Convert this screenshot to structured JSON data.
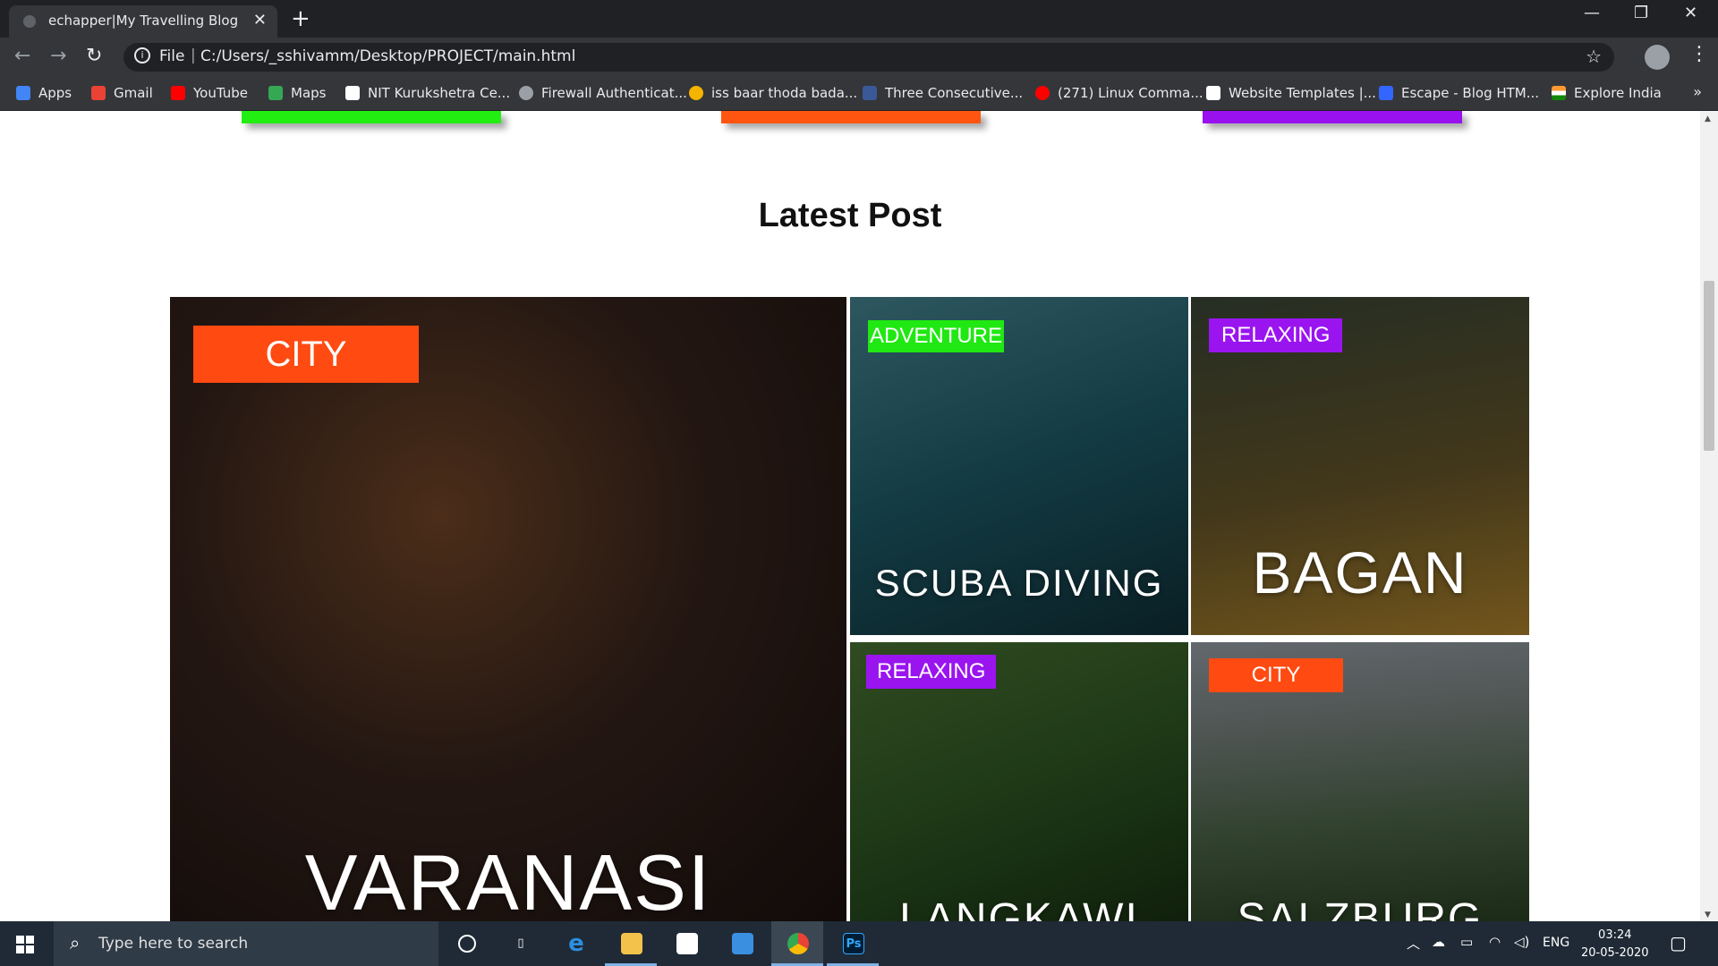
{
  "browser": {
    "tab_title": "echapper|My Travelling Blog",
    "new_tab": "+",
    "url_scheme": "File",
    "url": "C:/Users/_sshivamm/Desktop/PROJECT/main.html"
  },
  "bookmarks": [
    {
      "label": "Apps",
      "color": "#4285f4"
    },
    {
      "label": "Gmail",
      "color": "#ea4335"
    },
    {
      "label": "YouTube",
      "color": "#ff0000"
    },
    {
      "label": "Maps",
      "color": "#34a853"
    },
    {
      "label": "NIT Kurukshetra Ce...",
      "color": "#ffffff"
    },
    {
      "label": "Firewall Authenticat...",
      "color": "#9aa0a6"
    },
    {
      "label": "iss baar thoda bada...",
      "color": "#f4b400"
    },
    {
      "label": "Three Consecutive...",
      "color": "#3b5998"
    },
    {
      "label": "(271) Linux Comma...",
      "color": "#ff0000"
    },
    {
      "label": "Website Templates |...",
      "color": "#ffffff"
    },
    {
      "label": "Escape - Blog HTM...",
      "color": "#3366ff"
    },
    {
      "label": "Explore India",
      "color": "#ff9933"
    }
  ],
  "page": {
    "section_title": "Latest Post",
    "stripe_colors": [
      "#22ee11",
      "#ff5511",
      "#9911ee"
    ],
    "posts": [
      {
        "tag": "CITY",
        "tag_color": "#ff4a12",
        "place": "VARANASI",
        "bg": "#3a261e"
      },
      {
        "tag": "ADVENTURE",
        "tag_color": "#20e812",
        "place": "SCUBA DIVING",
        "bg": "#1f5f6c"
      },
      {
        "tag": "RELAXING",
        "tag_color": "#9a14f0",
        "place": "BAGAN",
        "bg": "#6b5a2c"
      },
      {
        "tag": "RELAXING",
        "tag_color": "#9a14f0",
        "place": "LANGKAWI",
        "bg": "#2f5a24"
      },
      {
        "tag": "CITY",
        "tag_color": "#ff4a12",
        "place": "SALZBURG",
        "bg": "#4f6a4a"
      }
    ]
  },
  "taskbar": {
    "search_placeholder": "Type here to search",
    "language": "ENG",
    "time": "03:24",
    "date": "20-05-2020",
    "apps": [
      "cortana",
      "task-view",
      "edge",
      "file-explorer",
      "store",
      "mail",
      "chrome",
      "photoshop"
    ],
    "photoshop_label": "Ps"
  }
}
